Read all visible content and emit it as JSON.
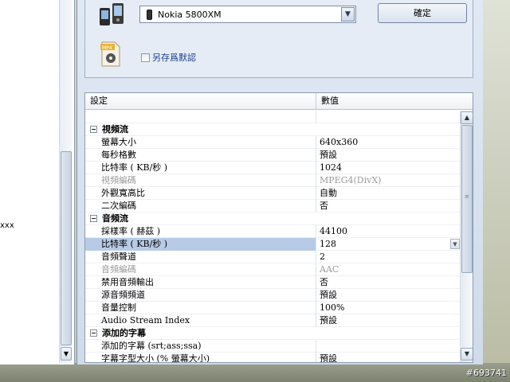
{
  "left_pane": {
    "visible_text": "xxx"
  },
  "device": {
    "selected": "Nokia 5800XM"
  },
  "ok_button": "確定",
  "save_default_label": "另存爲默認",
  "grid": {
    "headers": {
      "name": "設定",
      "value": "數值"
    },
    "rows": [
      {
        "type": "blank",
        "name": "",
        "value": ""
      },
      {
        "type": "category",
        "name": "視頻流",
        "value": ""
      },
      {
        "type": "prop",
        "name": "螢幕大小",
        "value": "640x360"
      },
      {
        "type": "prop",
        "name": "每秒格數",
        "value": "預設"
      },
      {
        "type": "prop",
        "name": "比特率 ( KB/秒 )",
        "value": "1024"
      },
      {
        "type": "disabled",
        "name": "視頻編碼",
        "value": "MPEG4(DivX)"
      },
      {
        "type": "prop",
        "name": "外觀寬高比",
        "value": "自動"
      },
      {
        "type": "prop",
        "name": "二次編碼",
        "value": "否"
      },
      {
        "type": "category",
        "name": "音頻流",
        "value": ""
      },
      {
        "type": "prop",
        "name": "採樣率 ( 赫茲 )",
        "value": "44100"
      },
      {
        "type": "selected",
        "name": "比特率 ( KB/秒 )",
        "value": "128"
      },
      {
        "type": "prop",
        "name": "音頻聲道",
        "value": "2"
      },
      {
        "type": "disabled",
        "name": "音頻編碼",
        "value": "AAC"
      },
      {
        "type": "prop",
        "name": "禁用音頻輸出",
        "value": "否"
      },
      {
        "type": "prop",
        "name": "源音頻頻道",
        "value": "預設"
      },
      {
        "type": "prop",
        "name": "音量控制",
        "value": "100%"
      },
      {
        "type": "prop",
        "name": "Audio Stream Index",
        "value": "預設"
      },
      {
        "type": "category",
        "name": "添加的字幕",
        "value": ""
      },
      {
        "type": "prop",
        "name": "添加的字幕 (srt;ass;ssa)",
        "value": ""
      },
      {
        "type": "prop",
        "name": "字幕字型大小 (% 螢幕大小)",
        "value": "預設"
      }
    ]
  },
  "watermark": "#693741",
  "colors": {
    "selected_row": "#b8cbe6",
    "disabled_text": "#9a9a9a",
    "link_blue": "#1c3d8a"
  }
}
